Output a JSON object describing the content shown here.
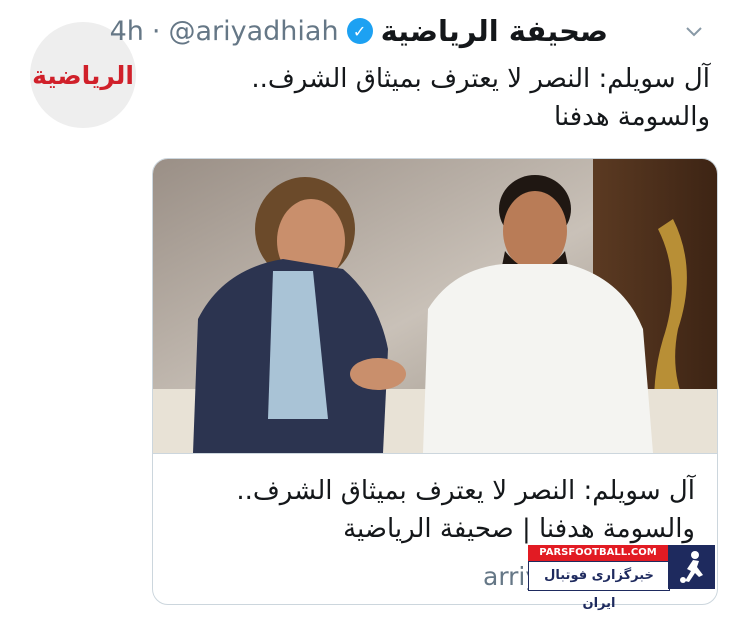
{
  "tweet": {
    "display_name": "صحيفة الرياضية",
    "handle": "@ariyadhiah",
    "separator": "·",
    "time": "4h",
    "avatar_logo": "الرياضية",
    "text": "آل سويلم: النصر لا يعترف بميثاق الشرف.. والسومة هدفنا"
  },
  "card": {
    "title": "آل سويلم: النصر لا يعترف بميثاق الشرف.. والسومة هدفنا | صحيفة الرياضية",
    "domain": "arriyadiyah.com"
  },
  "watermark": {
    "site": "PARSFOOTBALL.COM",
    "tagline": "خبرگزاری فوتبال ایران"
  },
  "icons": {
    "menu": "chevron-down-icon",
    "verified": "verified-badge-icon"
  },
  "colors": {
    "verified_blue": "#1da1f2",
    "meta_gray": "#657786",
    "brand_red": "#d0202a",
    "watermark_navy": "#1e2a5e"
  }
}
